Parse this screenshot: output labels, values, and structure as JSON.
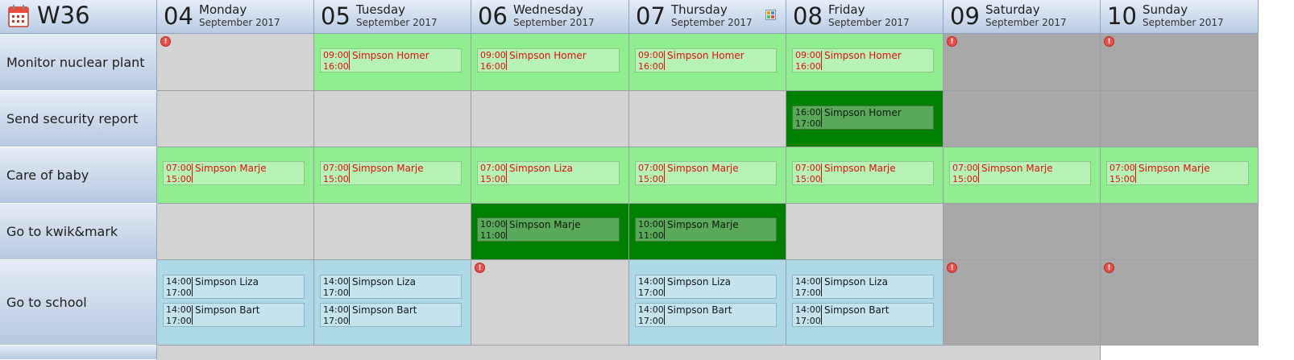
{
  "week": {
    "label": "W36"
  },
  "days": [
    {
      "num": "04",
      "name": "Monday",
      "month": "September 2017"
    },
    {
      "num": "05",
      "name": "Tuesday",
      "month": "September 2017"
    },
    {
      "num": "06",
      "name": "Wednesday",
      "month": "September 2017"
    },
    {
      "num": "07",
      "name": "Thursday",
      "month": "September 2017"
    },
    {
      "num": "08",
      "name": "Friday",
      "month": "September 2017"
    },
    {
      "num": "09",
      "name": "Saturday",
      "month": "September 2017"
    },
    {
      "num": "10",
      "name": "Sunday",
      "month": "September 2017"
    }
  ],
  "tasks": [
    {
      "label": "Monitor nuclear plant",
      "cells": [
        {
          "style": "empty",
          "warn": true,
          "appts": []
        },
        {
          "style": "green",
          "appts": [
            {
              "start": "09:00",
              "end": "16:00",
              "name": "Simpson Homer",
              "style": "red"
            }
          ]
        },
        {
          "style": "green",
          "appts": [
            {
              "start": "09:00",
              "end": "16:00",
              "name": "Simpson Homer",
              "style": "red"
            }
          ]
        },
        {
          "style": "green",
          "appts": [
            {
              "start": "09:00",
              "end": "16:00",
              "name": "Simpson Homer",
              "style": "red"
            }
          ]
        },
        {
          "style": "green",
          "appts": [
            {
              "start": "09:00",
              "end": "16:00",
              "name": "Simpson Homer",
              "style": "red"
            }
          ]
        },
        {
          "style": "weekend",
          "warn": true,
          "appts": []
        },
        {
          "style": "weekend",
          "warn": true,
          "appts": []
        }
      ]
    },
    {
      "label": "Send security report",
      "cells": [
        {
          "style": "empty",
          "appts": []
        },
        {
          "style": "empty",
          "appts": []
        },
        {
          "style": "empty",
          "appts": []
        },
        {
          "style": "empty",
          "appts": []
        },
        {
          "style": "dgreen",
          "appts": [
            {
              "start": "16:00",
              "end": "17:00",
              "name": "Simpson Homer",
              "style": "dark"
            }
          ]
        },
        {
          "style": "weekend",
          "appts": []
        },
        {
          "style": "weekend",
          "appts": []
        }
      ]
    },
    {
      "label": "Care of baby",
      "cells": [
        {
          "style": "green",
          "appts": [
            {
              "start": "07:00",
              "end": "15:00",
              "name": "Simpson Marje",
              "style": "red"
            }
          ]
        },
        {
          "style": "green",
          "appts": [
            {
              "start": "07:00",
              "end": "15:00",
              "name": "Simpson Marje",
              "style": "red"
            }
          ]
        },
        {
          "style": "green",
          "appts": [
            {
              "start": "07:00",
              "end": "15:00",
              "name": "Simpson Liza",
              "style": "red"
            }
          ]
        },
        {
          "style": "green",
          "appts": [
            {
              "start": "07:00",
              "end": "15:00",
              "name": "Simpson Marje",
              "style": "red"
            }
          ]
        },
        {
          "style": "green",
          "appts": [
            {
              "start": "07:00",
              "end": "15:00",
              "name": "Simpson Marje",
              "style": "red"
            }
          ]
        },
        {
          "style": "green",
          "appts": [
            {
              "start": "07:00",
              "end": "15:00",
              "name": "Simpson Marje",
              "style": "red"
            }
          ]
        },
        {
          "style": "green",
          "appts": [
            {
              "start": "07:00",
              "end": "15:00",
              "name": "Simpson Marje",
              "style": "red"
            }
          ]
        }
      ]
    },
    {
      "label": "Go to kwik&mark",
      "cells": [
        {
          "style": "empty",
          "appts": []
        },
        {
          "style": "empty",
          "appts": []
        },
        {
          "style": "dgreen",
          "appts": [
            {
              "start": "10:00",
              "end": "11:00",
              "name": "Simpson Marje",
              "style": "dark"
            }
          ]
        },
        {
          "style": "dgreen",
          "appts": [
            {
              "start": "10:00",
              "end": "11:00",
              "name": "Simpson Marje",
              "style": "dark"
            }
          ]
        },
        {
          "style": "empty",
          "appts": []
        },
        {
          "style": "weekend",
          "appts": []
        },
        {
          "style": "weekend",
          "appts": []
        }
      ]
    },
    {
      "label": "Go to school",
      "cells": [
        {
          "style": "blue",
          "appts": [
            {
              "start": "14:00",
              "end": "17:00",
              "name": "Simpson Liza",
              "style": "blue"
            },
            {
              "start": "14:00",
              "end": "17:00",
              "name": "Simpson Bart",
              "style": "blue"
            }
          ]
        },
        {
          "style": "blue",
          "appts": [
            {
              "start": "14:00",
              "end": "17:00",
              "name": "Simpson Liza",
              "style": "blue"
            },
            {
              "start": "14:00",
              "end": "17:00",
              "name": "Simpson Bart",
              "style": "blue"
            }
          ]
        },
        {
          "style": "empty",
          "warn": true,
          "appts": []
        },
        {
          "style": "blue",
          "appts": [
            {
              "start": "14:00",
              "end": "17:00",
              "name": "Simpson Liza",
              "style": "blue"
            },
            {
              "start": "14:00",
              "end": "17:00",
              "name": "Simpson Bart",
              "style": "blue"
            }
          ]
        },
        {
          "style": "blue",
          "appts": [
            {
              "start": "14:00",
              "end": "17:00",
              "name": "Simpson Liza",
              "style": "blue"
            },
            {
              "start": "14:00",
              "end": "17:00",
              "name": "Simpson Bart",
              "style": "blue"
            }
          ]
        },
        {
          "style": "weekend",
          "warn": true,
          "appts": []
        },
        {
          "style": "weekend",
          "warn": true,
          "appts": []
        }
      ]
    }
  ],
  "icons": {
    "calendar": "calendar-icon",
    "warning": "warning-icon",
    "day_view": "day-view-icon"
  },
  "colors": {
    "empty": "#d3d3d3",
    "weekend": "#a8a8a8",
    "green": "#90ee90",
    "dark_green": "#008000",
    "blue": "#add8e6",
    "warning": "#e8504b",
    "appt_text_red": "#e01010"
  }
}
